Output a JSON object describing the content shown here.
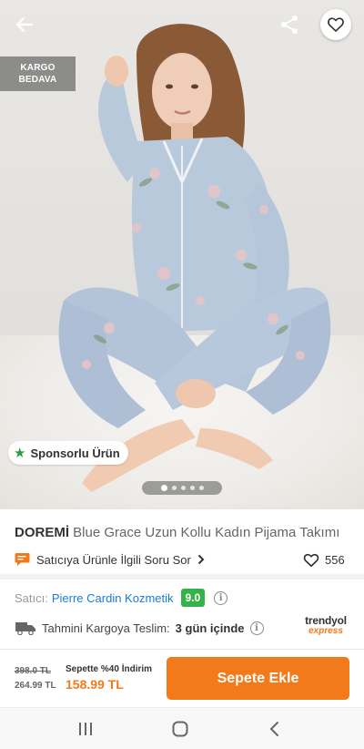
{
  "hero": {
    "badge_line1": "KARGO",
    "badge_line2": "BEDAVA",
    "sponsored_label": "Sponsorlu Ürün",
    "image_count": 5,
    "active_image": 1
  },
  "toolbar": {
    "back_icon": "arrow-left-icon",
    "share_icon": "share-icon",
    "favorite_icon": "heart-outline-icon"
  },
  "product": {
    "brand": "DOREMİ",
    "name": "Blue Grace Uzun Kollu Kadın Pijama Takımı",
    "question_link": "Satıcıya Ürünle İlgili Soru Sor",
    "favorite_count": "556"
  },
  "seller": {
    "label": "Satıcı:",
    "name": "Pierre Cardin Kozmetik",
    "score": "9.0"
  },
  "delivery": {
    "label": "Tahmini Kargoya Teslim:",
    "value": "3 gün içinde",
    "express_line1": "trendyol",
    "express_line2": "express"
  },
  "price": {
    "original": "398.0 TL",
    "discounted": "264.99 TL",
    "promo_label": "Sepette %40 İndirim",
    "final": "158.99 TL",
    "cart_button": "Sepete Ekle"
  },
  "colors": {
    "accent": "#f27a1a",
    "seller_link": "#1c7ad8",
    "score_badge": "#36b24a",
    "sponsor_star": "#2e9d3f"
  }
}
